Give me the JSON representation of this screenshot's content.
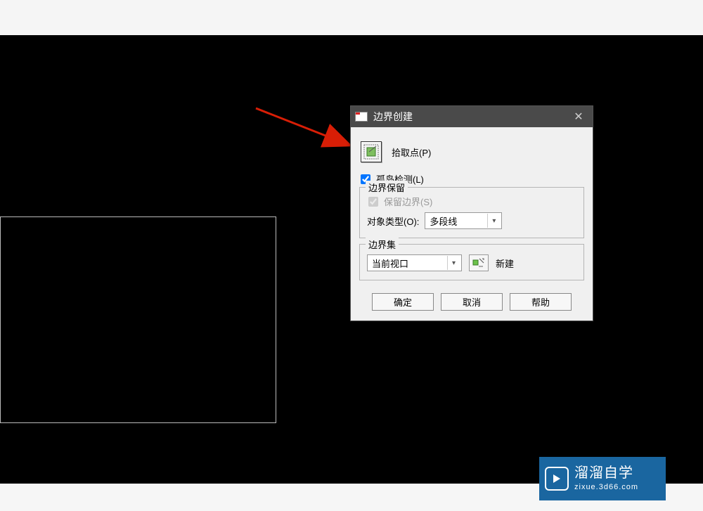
{
  "dialog": {
    "title": "边界创建",
    "pick_points_label": "拾取点(P)",
    "island_detection_label": "孤岛检测(L)",
    "boundary_retention": {
      "legend": "边界保留",
      "keep_boundary_label": "保留边界(S)",
      "object_type_label": "对象类型(O):",
      "object_type_value": "多段线"
    },
    "boundary_set": {
      "legend": "边界集",
      "view_value": "当前视口",
      "new_label": "新建"
    },
    "buttons": {
      "ok": "确定",
      "cancel": "取消",
      "help": "帮助"
    }
  },
  "watermark": {
    "brand": "溜溜自学",
    "site": "zixue.3d66.com"
  }
}
